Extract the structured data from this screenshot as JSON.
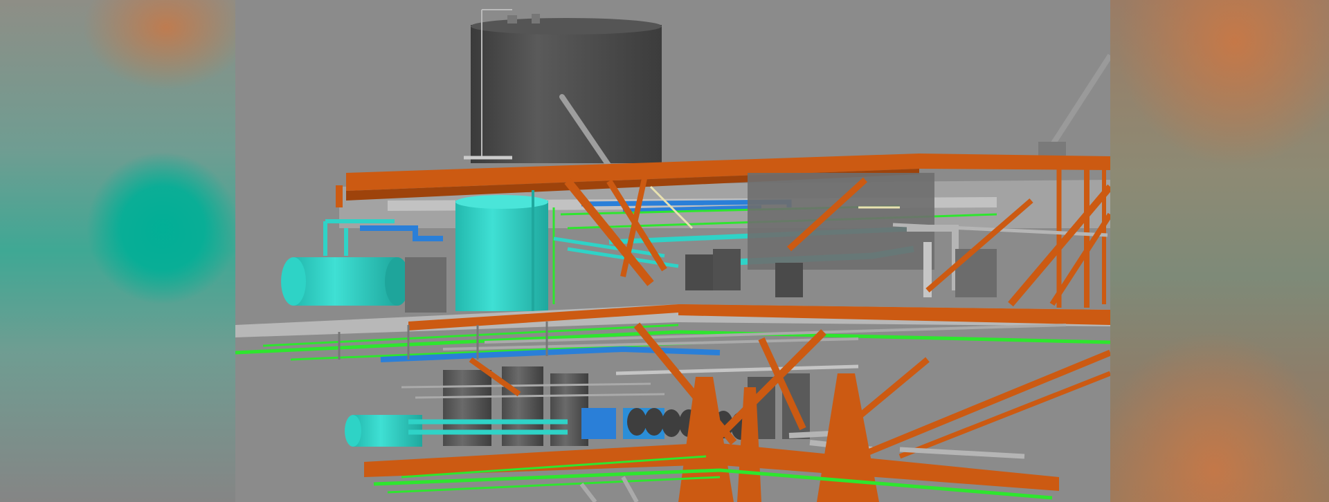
{
  "scene": {
    "subject": "offshore-platform-3d-model",
    "colors": {
      "structure": "#cc5a12",
      "equipment-cyan": "#2fd3c7",
      "pipe-green": "#2ee62e",
      "pipe-blue": "#2a7fd8",
      "tank-dark": "#4a4a4a",
      "steel-grey": "#b5b5b5",
      "background": "#8b8b8b"
    },
    "icons": []
  }
}
